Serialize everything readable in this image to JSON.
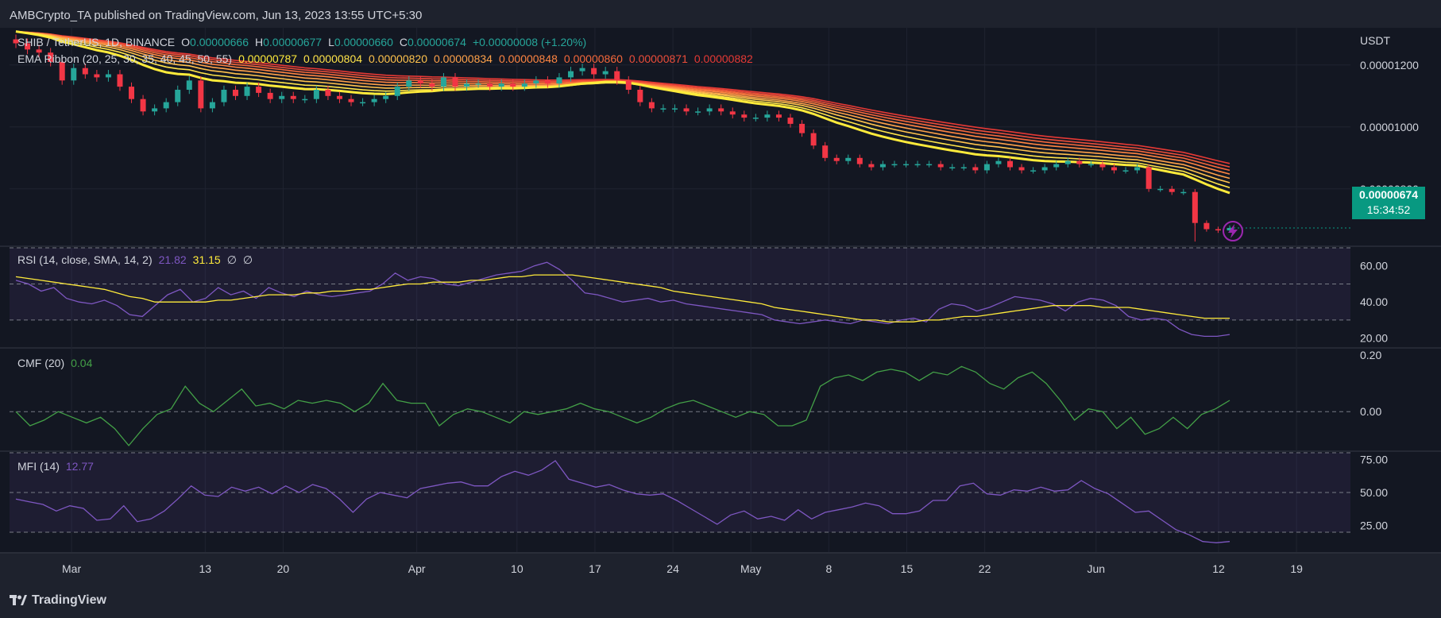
{
  "header": {
    "publisher": "AMBCrypto_TA published on TradingView.com, Jun 13, 2023 13:55 UTC+5:30"
  },
  "footer": {
    "brand": "TradingView"
  },
  "main": {
    "symbol": "SHIB / TetherUS, 1D, BINANCE",
    "ohlc": {
      "o_label": "O",
      "o": "0.00000666",
      "h_label": "H",
      "h": "0.00000677",
      "l_label": "L",
      "l": "0.00000660",
      "c_label": "C",
      "c": "0.00000674",
      "change": "+0.00000008 (+1.20%)"
    },
    "ema_title": "EMA Ribbon (20, 25, 30, 35, 40, 45, 50, 55)",
    "ema_values": [
      "0.00000787",
      "0.00000804",
      "0.00000820",
      "0.00000834",
      "0.00000848",
      "0.00000860",
      "0.00000871",
      "0.00000882"
    ],
    "ema_colors": [
      "#ffeb3b",
      "#ffe44a",
      "#ffc34d",
      "#ffa24a",
      "#ff8542",
      "#f5683b",
      "#ec4d3a",
      "#e53935"
    ],
    "currency": "USDT",
    "price_ticks": [
      "0.00001200",
      "0.00001000",
      "0.00000800"
    ],
    "last_price": "0.00000674",
    "countdown": "15:34:52"
  },
  "rsi": {
    "title": "RSI (14, close, SMA, 14, 2)",
    "value": "21.82",
    "sma_value": "31.15",
    "extra1": "∅",
    "extra2": "∅",
    "ticks": [
      "60.00",
      "40.00",
      "20.00"
    ]
  },
  "cmf": {
    "title": "CMF (20)",
    "value": "0.04",
    "ticks": [
      "0.20",
      "0.00"
    ]
  },
  "mfi": {
    "title": "MFI (14)",
    "value": "12.77",
    "ticks": [
      "75.00",
      "50.00",
      "25.00"
    ]
  },
  "time_axis": [
    "Mar",
    "13",
    "20",
    "Apr",
    "10",
    "17",
    "24",
    "May",
    "8",
    "15",
    "22",
    "Jun",
    "12",
    "19"
  ],
  "colors": {
    "up": "#26a69a",
    "down": "#f23645",
    "rsi": "#7e57c2",
    "rsi_sma": "#ffeb3b",
    "cmf": "#43a047",
    "mfi": "#7e57c2",
    "badge": "#089981"
  },
  "chart_data": [
    {
      "type": "candlestick",
      "title": "SHIB / TetherUS, 1D, BINANCE",
      "ylabel": "USDT",
      "ylim": [
        6.2e-06,
        1.32e-05
      ],
      "x_start": "2023-02-24",
      "x_end": "2023-06-13",
      "closes": [
        1.27e-05,
        1.25e-05,
        1.24e-05,
        1.21e-05,
        1.15e-05,
        1.19e-05,
        1.17e-05,
        1.16e-05,
        1.17e-05,
        1.13e-05,
        1.09e-05,
        1.05e-05,
        1.06e-05,
        1.08e-05,
        1.12e-05,
        1.15e-05,
        1.06e-05,
        1.08e-05,
        1.12e-05,
        1.1e-05,
        1.13e-05,
        1.11e-05,
        1.09e-05,
        1.1e-05,
        1.09e-05,
        1.09e-05,
        1.12e-05,
        1.1e-05,
        1.09e-05,
        1.08e-05,
        1.08e-05,
        1.09e-05,
        1.1e-05,
        1.13e-05,
        1.15e-05,
        1.14e-05,
        1.13e-05,
        1.16e-05,
        1.13e-05,
        1.14e-05,
        1.14e-05,
        1.13e-05,
        1.14e-05,
        1.13e-05,
        1.14e-05,
        1.15e-05,
        1.14e-05,
        1.16e-05,
        1.18e-05,
        1.19e-05,
        1.17e-05,
        1.18e-05,
        1.15e-05,
        1.12e-05,
        1.08e-05,
        1.06e-05,
        1.06e-05,
        1.06e-05,
        1.05e-05,
        1.05e-05,
        1.06e-05,
        1.05e-05,
        1.04e-05,
        1.03e-05,
        1.03e-05,
        1.04e-05,
        1.03e-05,
        1.01e-05,
        9.8e-06,
        9.4e-06,
        9e-06,
        8.9e-06,
        9e-06,
        8.8e-06,
        8.7e-06,
        8.8e-06,
        8.8e-06,
        8.8e-06,
        8.8e-06,
        8.8e-06,
        8.7e-06,
        8.7e-06,
        8.7e-06,
        8.6e-06,
        8.8e-06,
        8.9e-06,
        8.7e-06,
        8.6e-06,
        8.6e-06,
        8.7e-06,
        8.8e-06,
        8.9e-06,
        8.8e-06,
        8.8e-06,
        8.7e-06,
        8.6e-06,
        8.6e-06,
        8.7e-06,
        8e-06,
        8e-06,
        7.9e-06,
        7.9e-06,
        6.9e-06,
        6.7e-06,
        6.66e-06,
        6.74e-06
      ],
      "series": [
        {
          "name": "EMA 20",
          "last": 7.87e-06
        },
        {
          "name": "EMA 55",
          "last": 8.82e-06
        }
      ],
      "last_close": 6.74e-06
    },
    {
      "type": "line",
      "title": "RSI (14, close, SMA, 14, 2)",
      "ylim": [
        15,
        70
      ],
      "bands": [
        30,
        50,
        70
      ],
      "series": [
        {
          "name": "RSI",
          "values": [
            52,
            50,
            46,
            48,
            42,
            40,
            39,
            41,
            38,
            33,
            32,
            38,
            44,
            47,
            40,
            42,
            48,
            44,
            46,
            42,
            48,
            45,
            43,
            46,
            44,
            43,
            44,
            45,
            46,
            50,
            56,
            52,
            54,
            53,
            50,
            49,
            51,
            53,
            55,
            56,
            57,
            60,
            62,
            58,
            52,
            45,
            44,
            42,
            40,
            41,
            42,
            40,
            41,
            39,
            38,
            37,
            36,
            35,
            34,
            33,
            30,
            29,
            28,
            29,
            30,
            29,
            28,
            30,
            29,
            28,
            30,
            31,
            29,
            36,
            39,
            38,
            35,
            37,
            40,
            43,
            42,
            41,
            39,
            35,
            40,
            42,
            41,
            38,
            32,
            30,
            31,
            30,
            25,
            22,
            21,
            21,
            22
          ]
        },
        {
          "name": "SMA",
          "values": [
            54,
            53,
            52,
            51,
            50,
            49,
            48,
            47,
            45,
            43,
            42,
            40,
            40,
            40,
            40,
            40,
            41,
            41,
            42,
            43,
            44,
            44,
            44,
            45,
            45,
            46,
            46,
            47,
            47,
            48,
            49,
            50,
            50,
            51,
            51,
            51,
            52,
            52,
            53,
            54,
            54,
            55,
            55,
            55,
            55,
            54,
            53,
            52,
            51,
            50,
            49,
            48,
            46,
            45,
            44,
            43,
            42,
            41,
            40,
            39,
            37,
            36,
            35,
            34,
            33,
            32,
            31,
            30,
            30,
            29,
            29,
            29,
            30,
            30,
            31,
            32,
            32,
            33,
            34,
            35,
            36,
            37,
            38,
            38,
            38,
            38,
            37,
            37,
            37,
            36,
            35,
            34,
            33,
            32,
            31,
            31,
            31
          ]
        }
      ]
    },
    {
      "type": "line",
      "title": "CMF (20)",
      "ylim": [
        -0.14,
        0.22
      ],
      "bands": [
        0
      ],
      "series": [
        {
          "name": "CMF",
          "values": [
            0.0,
            -0.05,
            -0.03,
            0.0,
            -0.02,
            -0.04,
            -0.02,
            -0.06,
            -0.12,
            -0.06,
            -0.01,
            0.01,
            0.09,
            0.03,
            0.0,
            0.04,
            0.08,
            0.02,
            0.03,
            0.01,
            0.04,
            0.03,
            0.04,
            0.03,
            0.0,
            0.03,
            0.1,
            0.04,
            0.03,
            0.03,
            -0.05,
            -0.01,
            0.01,
            0.0,
            -0.02,
            -0.04,
            0.0,
            -0.01,
            0.0,
            0.01,
            0.03,
            0.01,
            0.0,
            -0.02,
            -0.04,
            -0.02,
            0.01,
            0.03,
            0.04,
            0.02,
            0.0,
            -0.02,
            0.0,
            -0.01,
            -0.05,
            -0.05,
            -0.03,
            0.09,
            0.12,
            0.13,
            0.11,
            0.14,
            0.15,
            0.14,
            0.11,
            0.14,
            0.13,
            0.16,
            0.14,
            0.1,
            0.08,
            0.12,
            0.14,
            0.1,
            0.04,
            -0.03,
            0.01,
            0.0,
            -0.06,
            -0.02,
            -0.08,
            -0.06,
            -0.02,
            -0.06,
            -0.01,
            0.01,
            0.04
          ]
        }
      ]
    },
    {
      "type": "line",
      "title": "MFI (14)",
      "ylim": [
        5,
        80
      ],
      "bands": [
        20,
        50,
        80
      ],
      "series": [
        {
          "name": "MFI",
          "values": [
            45,
            43,
            41,
            36,
            40,
            38,
            29,
            30,
            40,
            28,
            30,
            36,
            45,
            55,
            48,
            47,
            54,
            51,
            54,
            49,
            55,
            50,
            56,
            53,
            45,
            35,
            45,
            50,
            48,
            46,
            53,
            55,
            57,
            58,
            55,
            55,
            62,
            66,
            63,
            67,
            74,
            60,
            57,
            54,
            56,
            52,
            49,
            48,
            49,
            44,
            38,
            32,
            26,
            33,
            36,
            30,
            32,
            29,
            37,
            30,
            35,
            37,
            39,
            42,
            40,
            34,
            34,
            36,
            44,
            44,
            55,
            57,
            49,
            48,
            52,
            51,
            54,
            51,
            52,
            59,
            53,
            49,
            42,
            35,
            36,
            29,
            22,
            18,
            13,
            12,
            13
          ]
        }
      ]
    }
  ]
}
